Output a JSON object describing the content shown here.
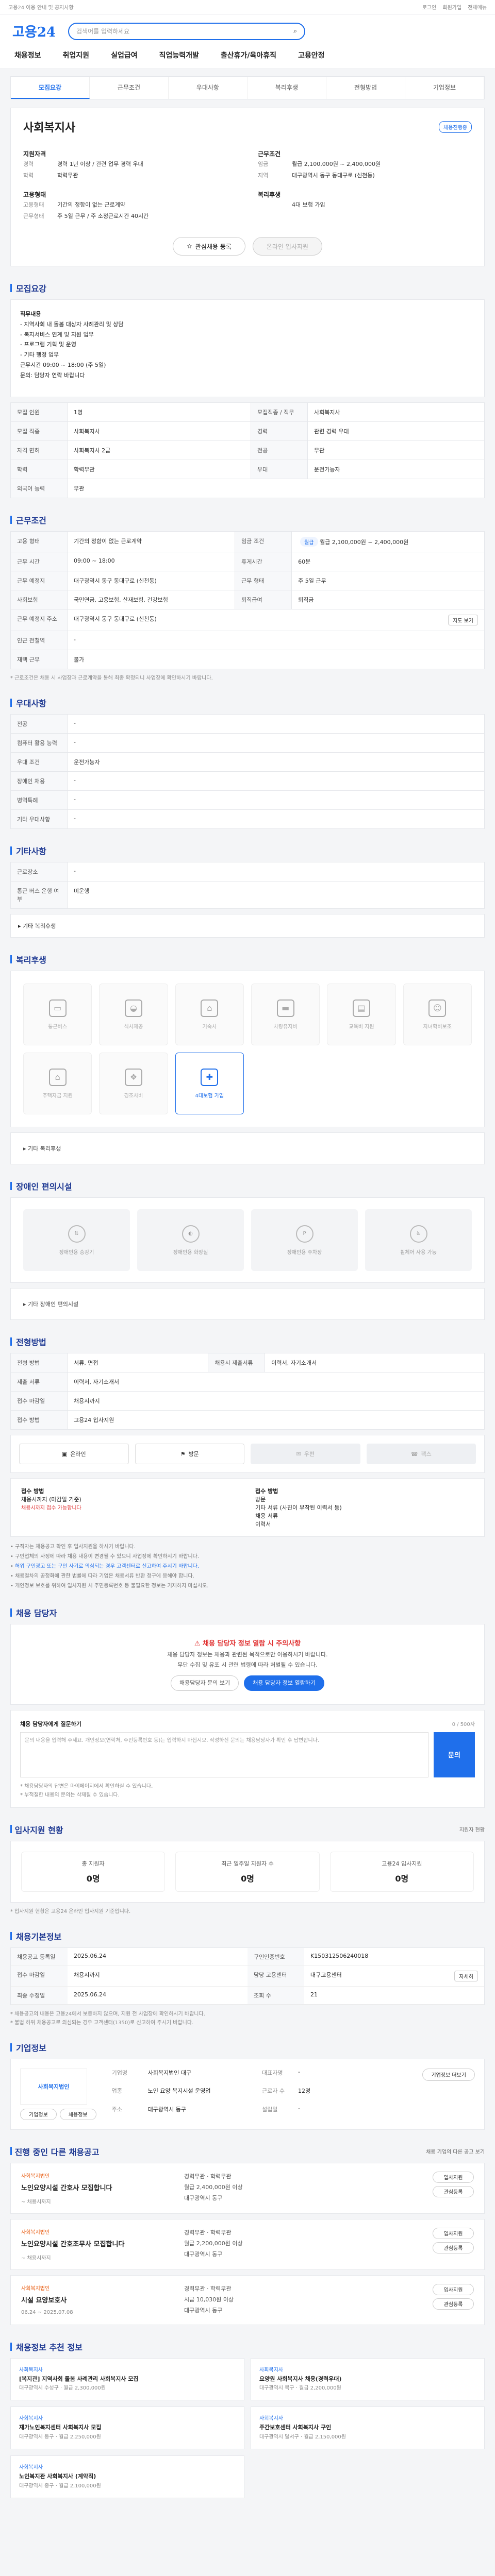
{
  "topbar": {
    "notice": "고용24 이용 안내 및 공지사항",
    "links": [
      "로그인",
      "회원가입",
      "전체메뉴"
    ]
  },
  "header": {
    "logo": "고용24",
    "search_placeholder": "검색어를 입력하세요",
    "gnb": [
      "채용정보",
      "취업지원",
      "실업급여",
      "직업능력개발",
      "출산휴가/육아휴직",
      "고용안정"
    ]
  },
  "tabs": [
    "모집요강",
    "근무조건",
    "우대사항",
    "복리후생",
    "전형방법",
    "기업정보"
  ],
  "company": {
    "name": "사회복지사",
    "badge": "채용진행중",
    "left_title": "지원자격",
    "left": [
      {
        "k": "경력",
        "v": "경력 1년 이상 / 관련 업무 경력 우대"
      },
      {
        "k": "학력",
        "v": "학력무관"
      }
    ],
    "left2_title": "고용형태",
    "left2": [
      {
        "k": "고용형태",
        "v": "기간의 정함이 없는 근로계약"
      },
      {
        "k": "근무형태",
        "v": "주 5일 근무 / 주 소정근로시간 40시간"
      }
    ],
    "right_title": "근무조건",
    "right": [
      {
        "k": "임금",
        "v": "월급 2,100,000원 ~ 2,400,000원"
      },
      {
        "k": "지역",
        "v": "대구광역시 동구 동대구로 (신천동)"
      }
    ],
    "right2_title": "복리후생",
    "right2": [
      {
        "k": "",
        "v": "4대 보험 가입"
      }
    ],
    "btn_apply": "온라인 입사지원",
    "btn_scrap": "관심채용 등록"
  },
  "sections": {
    "recruit": "모집요강",
    "cond": "근무조건",
    "pref": "우대사항",
    "other_cond": "기타사항",
    "welfare": "복리후생",
    "disab": "장애인 편의시설",
    "method": "전형방법",
    "docs": "전형방법",
    "contact": "채용 담당자",
    "inquiry": "입사지원 현황",
    "basic": "채용기본정보",
    "company": "기업정보",
    "jobs": "진행 중인 다른 채용공고",
    "recommend": "채용정보 추천 정보"
  },
  "recruit_desc": [
    "직무내용",
    "- 지역사회 내 돌봄 대상자 사례관리 및 상담",
    "- 복지서비스 연계 및 지원 업무",
    "- 프로그램 기획 및 운영",
    "- 기타 행정 업무",
    "",
    "근무시간 09:00 ~ 18:00 (주 5일)",
    "문의: 담당자 연락 바랍니다"
  ],
  "recruit_table": [
    {
      "k": "모집 인원",
      "v": "1명",
      "k2": "모집직종 / 직무",
      "v2": "사회복지사"
    },
    {
      "k": "모집 직종",
      "v": "사회복지사",
      "k2": "경력",
      "v2": "관련 경력 우대"
    },
    {
      "k": "자격 면허",
      "v": "사회복지사 2급",
      "k2": "전공",
      "v2": "무관"
    },
    {
      "k": "학력",
      "v": "학력무관",
      "k2": "우대",
      "v2": "운전가능자"
    },
    {
      "k": "외국어 능력",
      "v": "무관",
      "k2": "",
      "v2": ""
    }
  ],
  "cond_table": [
    {
      "k": "고용 형태",
      "v": "기간의 정함이 없는 근로계약",
      "k2": "임금 조건",
      "v2": "월급 2,100,000원 ~ 2,400,000원"
    },
    {
      "k": "근무 시간",
      "v": "09:00 ~ 18:00",
      "k2": "휴게시간",
      "v2": "60분"
    },
    {
      "k": "근무 예정지",
      "v": "대구광역시 동구 동대구로 (신천동)",
      "k2": "근무 형태",
      "v2": "주 5일 근무"
    },
    {
      "k": "사회보험",
      "v": "국민연금, 고용보험, 산재보험, 건강보험",
      "k2": "퇴직급여",
      "v2": "퇴직금"
    },
    {
      "k": "근무 예정지 주소",
      "v": "대구광역시 동구 동대구로 (신천동)",
      "k2": "",
      "v2": ""
    },
    {
      "k": "인근 전철역",
      "v": "-",
      "k2": "",
      "v2": ""
    },
    {
      "k": "재택 근무",
      "v": "불가",
      "k2": "",
      "v2": ""
    }
  ],
  "cond_pill": "월급",
  "cond_note": "* 근로조건은 채용 시 사업장과 근로계약을 통해 최종 확정되니 사업장에 확인하시기 바랍니다.",
  "map_btn": "지도 보기",
  "pref_table": [
    {
      "k": "전공",
      "v": "-"
    },
    {
      "k": "컴퓨터 활용 능력",
      "v": "-"
    },
    {
      "k": "우대 조건",
      "v": "운전가능자"
    },
    {
      "k": "장애인 채용",
      "v": "-"
    },
    {
      "k": "병역특례",
      "v": "-"
    },
    {
      "k": "기타 우대사항",
      "v": "-"
    }
  ],
  "other_table": [
    {
      "k": "근로장소",
      "v": "-"
    },
    {
      "k": "통근 버스 운행 여부",
      "v": "미운행"
    }
  ],
  "other_link": "기타 복리후생",
  "welfare": [
    {
      "label": "통근버스",
      "on": false,
      "icon": "bus-icon",
      "glyph": "▭"
    },
    {
      "label": "식사제공",
      "on": false,
      "icon": "meal-icon",
      "glyph": "◒"
    },
    {
      "label": "기숙사",
      "on": false,
      "icon": "house-icon",
      "glyph": "⌂"
    },
    {
      "label": "차량유지비",
      "on": false,
      "icon": "car-icon",
      "glyph": "▬"
    },
    {
      "label": "교육비 지원",
      "on": false,
      "icon": "book-icon",
      "glyph": "▤"
    },
    {
      "label": "자녀학비보조",
      "on": false,
      "icon": "child-icon",
      "glyph": "☺"
    },
    {
      "label": "주택자금 지원",
      "on": false,
      "icon": "home-loan-icon",
      "glyph": "⌂"
    },
    {
      "label": "경조사비",
      "on": false,
      "icon": "gift-icon",
      "glyph": "❖"
    },
    {
      "label": "4대보험 가입",
      "on": true,
      "icon": "insurance-icon",
      "glyph": "✚"
    }
  ],
  "welfare_other": "기타 복리후생",
  "disab": [
    {
      "label": "장애인용 승강기",
      "icon": "elevator-icon"
    },
    {
      "label": "장애인용 화장실",
      "icon": "toilet-icon"
    },
    {
      "label": "장애인용 주차장",
      "icon": "parking-icon"
    },
    {
      "label": "휠체어 사용 가능",
      "icon": "wheelchair-icon"
    }
  ],
  "disab_other": "기타 장애인 편의시설",
  "method_table": [
    {
      "k": "전형 방법",
      "v": "서류, 면접",
      "k2": "채용시 제출서류",
      "v2": "이력서, 자기소개서"
    },
    {
      "k": "제출 서류",
      "v": "이력서, 자기소개서",
      "k2": "",
      "v2": ""
    },
    {
      "k": "접수 마감일",
      "v": "채용시까지",
      "k2": "",
      "v2": ""
    },
    {
      "k": "접수 방법",
      "v": "고용24 입사지원",
      "k2": "",
      "v2": ""
    }
  ],
  "methods": [
    {
      "label": "온라인",
      "off": false,
      "icon": "online-icon"
    },
    {
      "label": "방문",
      "off": false,
      "icon": "visit-icon"
    },
    {
      "label": "우편",
      "off": true,
      "icon": "mail-icon"
    },
    {
      "label": "팩스",
      "off": true,
      "icon": "fax-icon"
    }
  ],
  "docs": {
    "left_title": "접수 방법",
    "left_sub": "채용시까지 (마감일 기준)",
    "left_red": "채용시까지 접수 가능합니다",
    "right_title": "접수 방법",
    "right_lines": [
      "방문",
      "기타 서류 (사진이 부착된 이력서 등)",
      "채용 서류",
      "이력서"
    ]
  },
  "bullets": [
    "구직자는 채용공고 확인 후 입사지원을 하시기 바랍니다.",
    "구인업체의 사정에 따라 채용 내용이 변경될 수 있으니 사업장에 확인하시기 바랍니다.",
    "허위 구인광고 또는 구인 사기로 의심되는 경우 고객센터로 신고하여 주시기 바랍니다.",
    "채용절차의 공정화에 관한 법률에 따라 기업은 채용서류 반환 청구에 응해야 합니다.",
    "개인정보 보호를 위하여 입사지원 시 주민등록번호 등 불필요한 정보는 기재하지 마십시오."
  ],
  "contact": {
    "warn": "채용 담당자 정보 열람 시 주의사항",
    "lines": [
      "채용 담당자 정보는 채용과 관련된 목적으로만 이용하시기 바랍니다.",
      "무단 수집 및 유포 시 관련 법령에 따라 처벌될 수 있습니다."
    ],
    "btn1": "채용담당자 문의 보기",
    "btn2": "채용 담당자 정보 열람하기"
  },
  "inquiry": {
    "title": "채용 담당자에게 질문하기",
    "sub": "0 / 500자",
    "placeholder": "문의 내용을 입력해 주세요. 개인정보(연락처, 주민등록번호 등)는 입력하지 마십시오. 작성하신 문의는 채용담당자가 확인 후 답변합니다.",
    "submit": "문의",
    "notes": [
      "* 채용담당자의 답변은 마이페이지에서 확인하실 수 있습니다.",
      "* 부적절한 내용의 문의는 삭제될 수 있습니다."
    ]
  },
  "stats": {
    "more": "지원자 현황",
    "items": [
      {
        "label": "총 지원자",
        "num": "0명"
      },
      {
        "label": "최근 일주일 지원자 수",
        "num": "0명"
      },
      {
        "label": "고용24 입사지원",
        "num": "0명"
      }
    ],
    "note": "* 입사지원 현황은 고용24 온라인 입사지원 기준입니다."
  },
  "basic": [
    {
      "k": "채용공고 등록일",
      "v": "2025.06.24",
      "k2": "구인인증번호",
      "v2": "K150312506240018"
    },
    {
      "k": "접수 마감일",
      "v": "채용시까지",
      "k2": "담당 고용센터",
      "v2": "대구고용센터"
    },
    {
      "k": "최종 수정일",
      "v": "2025.06.24",
      "k2": "조회 수",
      "v2": "21"
    }
  ],
  "basic_more": "자세히",
  "basic_notes": [
    "* 채용공고의 내용은 고용24에서 보증하지 않으며, 지원 전 사업장에 확인하시기 바랍니다.",
    "* 불법 허위 채용공고로 의심되는 경우 고객센터(1350)로 신고하여 주시기 바랍니다."
  ],
  "co": {
    "logo": "사회복지법인",
    "link1": "기업정보",
    "link2": "채용정보",
    "rows": [
      {
        "k": "기업명",
        "v": "사회복지법인 대구",
        "k2": "대표자명",
        "v2": "-"
      },
      {
        "k": "업종",
        "v": "노인 요양 복지시설 운영업",
        "k2": "근로자 수",
        "v2": "12명"
      },
      {
        "k": "주소",
        "v": "대구광역시 동구",
        "k2": "설립일",
        "v2": "-"
      }
    ],
    "more": "기업정보 더보기"
  },
  "jobs": [
    {
      "cname": "사회복지법인",
      "title": "노인요양시설 간호사 모집합니다",
      "date": "~ 채용시까지",
      "meta": [
        "경력무관 · 학력무관",
        "월급 2,400,000원 이상",
        "대구광역시 동구"
      ],
      "acts": [
        "입사지원",
        "관심등록"
      ]
    },
    {
      "cname": "사회복지법인",
      "title": "노인요양시설 간호조무사 모집합니다",
      "date": "~ 채용시까지",
      "meta": [
        "경력무관 · 학력무관",
        "월급 2,200,000원 이상",
        "대구광역시 동구"
      ],
      "acts": [
        "입사지원",
        "관심등록"
      ]
    },
    {
      "cname": "사회복지법인",
      "title": "시설 요양보호사",
      "date": "06.24 ~ 2025.07.08",
      "meta": [
        "경력무관 · 학력무관",
        "시급 10,030원 이상",
        "대구광역시 동구"
      ],
      "acts": [
        "입사지원",
        "관심등록"
      ]
    }
  ],
  "jobs_more": "채용 기업의 다른 공고 보기",
  "recs": [
    {
      "cat": "사회복지사",
      "t": "[복지관] 지역사회 돌봄 사례관리 사회복지사 모집",
      "m": "대구광역시 수성구 · 월급 2,300,000원"
    },
    {
      "cat": "사회복지사",
      "t": "요양원 사회복지사 채용(경력우대)",
      "m": "대구광역시 북구 · 월급 2,200,000원"
    },
    {
      "cat": "사회복지사",
      "t": "재가노인복지센터 사회복지사 모집",
      "m": "대구광역시 동구 · 월급 2,250,000원"
    },
    {
      "cat": "사회복지사",
      "t": "주간보호센터 사회복지사 구인",
      "m": "대구광역시 달서구 · 월급 2,150,000원"
    },
    {
      "cat": "사회복지사",
      "t": "노인복지관 사회복지사 (계약직)",
      "m": "대구광역시 중구 · 월급 2,100,000원"
    }
  ]
}
